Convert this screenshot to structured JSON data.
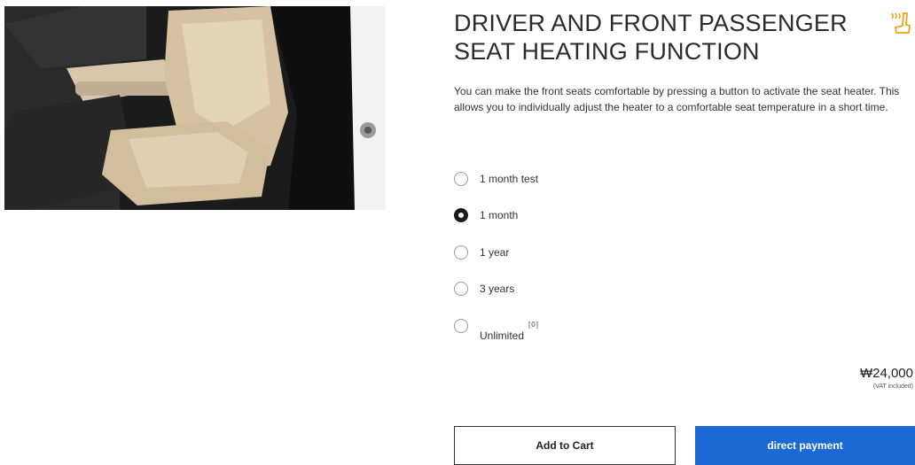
{
  "product": {
    "title_line1": "DRIVER AND FRONT PASSENGER",
    "title_line2": "SEAT HEATING FUNCTION",
    "description": "You can make the front seats comfortable by pressing a button to activate the seat heater. This allows you to individually adjust the heater to a comfortable seat temperature in a short time.",
    "icon": "heated-seat-icon",
    "icon_color": "#e8a31a"
  },
  "options": [
    {
      "label": "1 month test",
      "selected": false
    },
    {
      "label": "1 month",
      "selected": true
    },
    {
      "label": "1 year",
      "selected": false
    },
    {
      "label": "3 years",
      "selected": false
    },
    {
      "label": "Unlimited",
      "selected": false,
      "footnote": "[0]"
    }
  ],
  "price": {
    "amount": "₩24,000",
    "note": "(VAT included)"
  },
  "actions": {
    "add_to_cart": "Add to Cart",
    "direct_payment": "direct payment"
  },
  "colors": {
    "primary_button": "#1c69d4"
  }
}
